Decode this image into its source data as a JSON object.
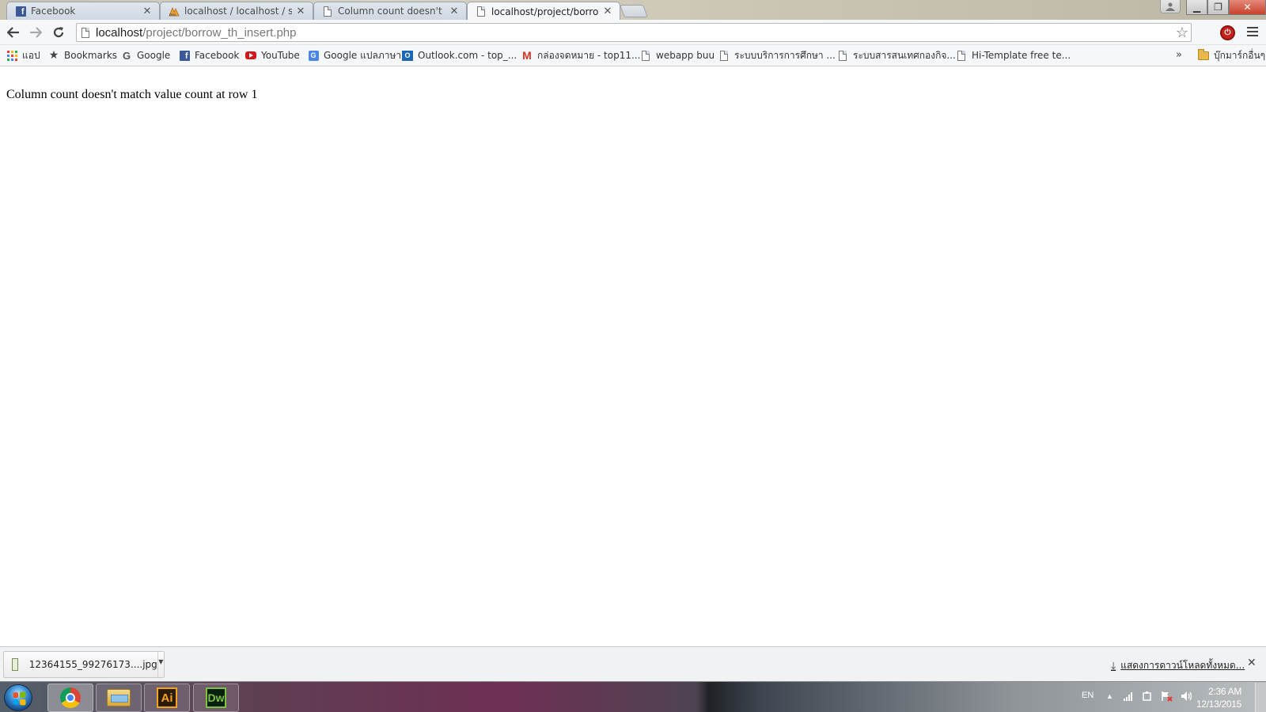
{
  "tabs": [
    {
      "title": "Facebook",
      "icon": "facebook-icon",
      "active": false
    },
    {
      "title": "localhost / localhost / scho",
      "icon": "phpmyadmin-icon",
      "active": false
    },
    {
      "title": "Column count doesn't mat",
      "icon": "page-icon",
      "active": false
    },
    {
      "title": "localhost/project/borrow_",
      "icon": "page-icon",
      "active": true
    }
  ],
  "toolbar": {
    "url_host": "localhost",
    "url_path": "/project/borrow_th_insert.php"
  },
  "bookmarks": [
    {
      "label": "แอป",
      "icon": "apps-icon"
    },
    {
      "label": "Bookmarks",
      "icon": "star-icon"
    },
    {
      "label": "Google",
      "icon": "google-icon"
    },
    {
      "label": "Facebook",
      "icon": "facebook-icon"
    },
    {
      "label": "YouTube",
      "icon": "youtube-icon"
    },
    {
      "label": "Google แปลภาษา",
      "icon": "google-translate-icon"
    },
    {
      "label": "Outlook.com - top_...",
      "icon": "outlook-icon"
    },
    {
      "label": "กล่องจดหมาย - top11...",
      "icon": "gmail-icon"
    },
    {
      "label": "webapp buu",
      "icon": "page-icon"
    },
    {
      "label": "ระบบบริการการศึกษา ...",
      "icon": "page-icon"
    },
    {
      "label": "ระบบสารสนเทศกองกิจ...",
      "icon": "page-icon"
    },
    {
      "label": "Hi-Template free te...",
      "icon": "page-icon"
    }
  ],
  "bookmarks_more": "»",
  "other_bookmarks": "บุ๊กมาร์กอื่นๆ",
  "page": {
    "message": "Column count doesn't match value count at row 1"
  },
  "download_shelf": {
    "file_name": "12364155_99276173....jpg",
    "show_all_label": "แสดงการดาวน์โหลดทั้งหมด..."
  },
  "taskbar": {
    "language": "EN",
    "time": "2:36 AM",
    "date": "12/13/2015"
  },
  "colors": {
    "facebook": "#3b5998",
    "youtube": "#d3171a",
    "close_button": "#c9412c"
  }
}
